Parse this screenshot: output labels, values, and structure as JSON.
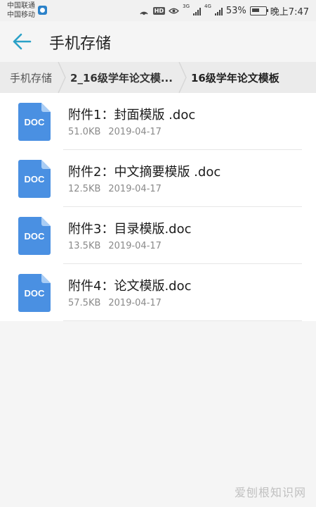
{
  "status_bar": {
    "carrier_1": "中国联通",
    "carrier_2": "中国移动",
    "net_1": "3G",
    "net_2": "4G",
    "battery": "53%",
    "time": "晚上7:47"
  },
  "header": {
    "title": "手机存储"
  },
  "breadcrumb": [
    {
      "label": "手机存储"
    },
    {
      "label": "2_16级学年论文模..."
    },
    {
      "label": "16级学年论文模板"
    }
  ],
  "files": [
    {
      "icon_label": "DOC",
      "name": "附件1：封面模版 .doc",
      "size": "51.0KB",
      "date": "2019-04-17"
    },
    {
      "icon_label": "DOC",
      "name": "附件2：中文摘要模版 .doc",
      "size": "12.5KB",
      "date": "2019-04-17"
    },
    {
      "icon_label": "DOC",
      "name": "附件3：目录模版.doc",
      "size": "13.5KB",
      "date": "2019-04-17"
    },
    {
      "icon_label": "DOC",
      "name": "附件4：论文模版.doc",
      "size": "57.5KB",
      "date": "2019-04-17"
    }
  ],
  "watermark": "爱刨根知识网",
  "colors": {
    "accent": "#2aa1c7",
    "doc_icon": "#4a90e2",
    "background": "#f5f5f5"
  }
}
